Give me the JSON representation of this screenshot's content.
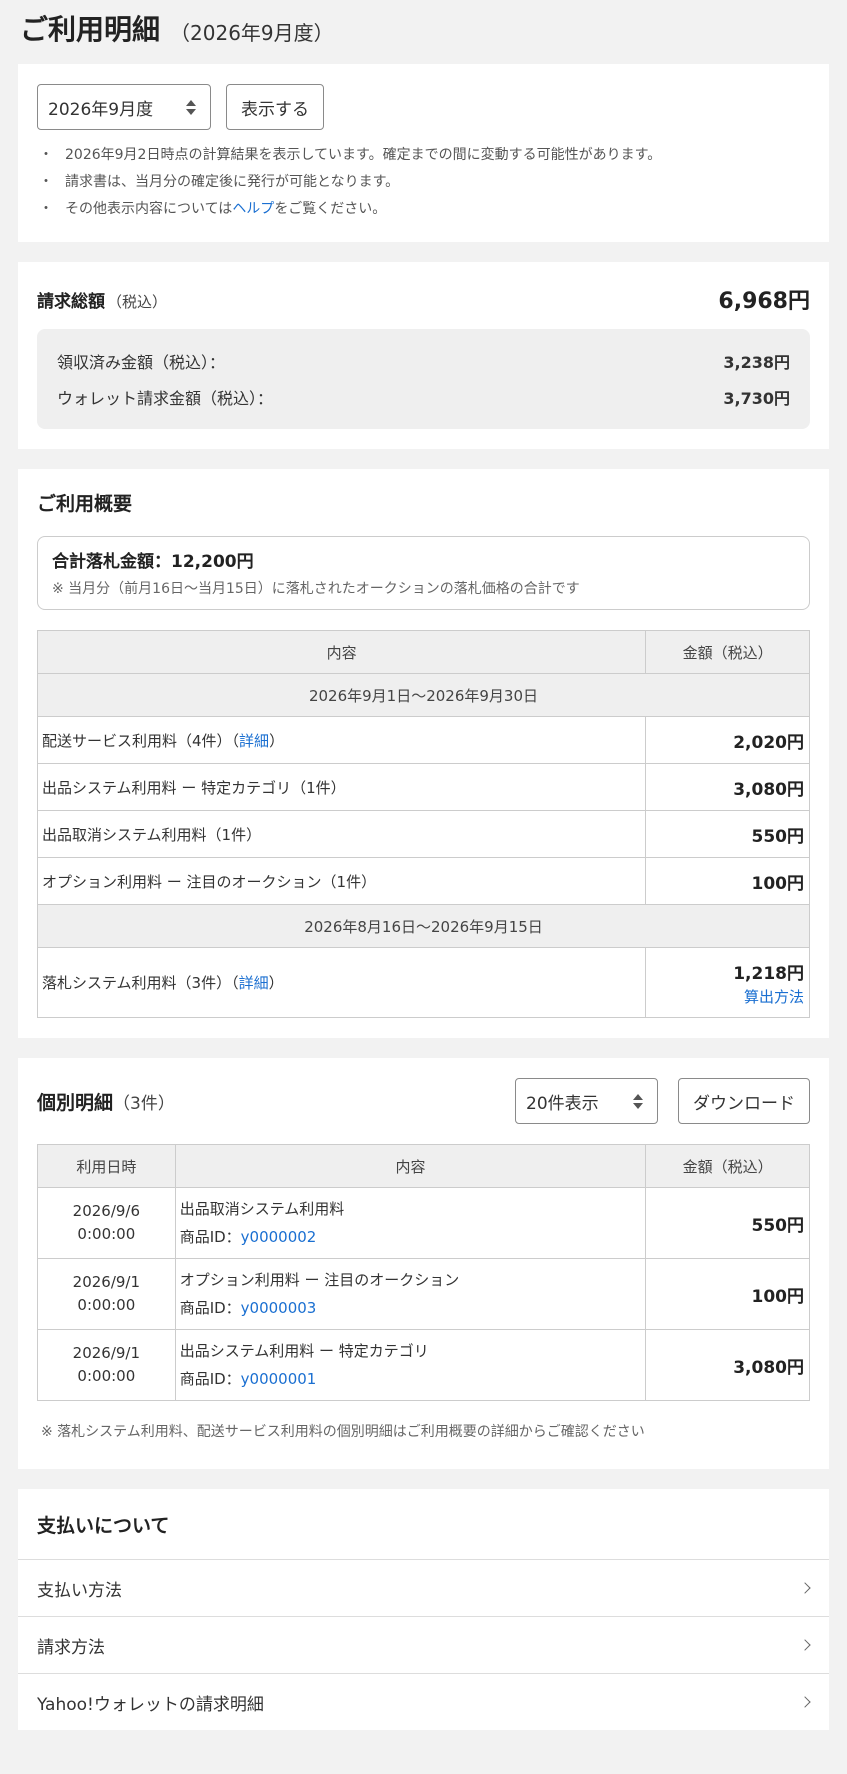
{
  "header": {
    "title": "ご利用明細",
    "subtitle": "（2026年9月度）"
  },
  "filter": {
    "month_selected": "2026年9月度",
    "show_button": "表示する",
    "notes": [
      "2026年9月2日時点の計算結果を表示しています。確定までの間に変動する可能性があります。",
      "請求書は、当月分の確定後に発行が可能となります。"
    ],
    "help_prefix": "その他表示内容については",
    "help_link": "ヘルプ",
    "help_suffix": "をご覧ください。"
  },
  "billing": {
    "total_label": "請求総額",
    "total_tax": "（税込）",
    "total_value": "6,968円",
    "received_label": "領収済み金額（税込）：",
    "received_value": "3,238円",
    "wallet_label": "ウォレット請求金額（税込）：",
    "wallet_value": "3,730円"
  },
  "summary": {
    "title": "ご利用概要",
    "bid_total": "合計落札金額：12,200円",
    "bid_note": "※ 当月分（前月16日〜当月15日）に落札されたオークションの落札価格の合計です",
    "col_content": "内容",
    "col_amount": "金額（税込）",
    "period1": "2026年9月1日〜2026年9月30日",
    "rows1": [
      {
        "name": "配送サービス利用料（4件）（",
        "link": "詳細",
        "tail": "）",
        "amount": "2,020円"
      },
      {
        "name": "出品システム利用料 ー 特定カテゴリ（1件）",
        "link": "",
        "tail": "",
        "amount": "3,080円"
      },
      {
        "name": "出品取消システム利用料（1件）",
        "link": "",
        "tail": "",
        "amount": "550円"
      },
      {
        "name": "オプション利用料 ー 注目のオークション（1件）",
        "link": "",
        "tail": "",
        "amount": "100円"
      }
    ],
    "period2": "2026年8月16日〜2026年9月15日",
    "row2": {
      "name": "落札システム利用料（3件）（",
      "link": "詳細",
      "tail": "）",
      "amount": "1,218円",
      "calc_link": "算出方法"
    }
  },
  "details": {
    "title": "個別明細",
    "count": "（3件）",
    "per_page": "20件表示",
    "download": "ダウンロード",
    "col_date": "利用日時",
    "col_content": "内容",
    "col_amount": "金額（税込）",
    "rows": [
      {
        "date": "2026/9/6",
        "time": "0:00:00",
        "desc": "出品取消システム利用料",
        "id_label": "商品ID：",
        "id": "y0000002",
        "amount": "550円"
      },
      {
        "date": "2026/9/1",
        "time": "0:00:00",
        "desc": "オプション利用料 ー 注目のオークション",
        "id_label": "商品ID：",
        "id": "y0000003",
        "amount": "100円"
      },
      {
        "date": "2026/9/1",
        "time": "0:00:00",
        "desc": "出品システム利用料 ー 特定カテゴリ",
        "id_label": "商品ID：",
        "id": "y0000001",
        "amount": "3,080円"
      }
    ],
    "footnote": "※ 落札システム利用料、配送サービス利用料の個別明細はご利用概要の詳細からご確認ください"
  },
  "payment": {
    "title": "支払いについて",
    "items": [
      "支払い方法",
      "請求方法",
      "Yahoo!ウォレットの請求明細"
    ]
  },
  "colors": {
    "link": "#1a6fd1",
    "background": "#f2f2f2",
    "header_cell": "#efefef"
  }
}
